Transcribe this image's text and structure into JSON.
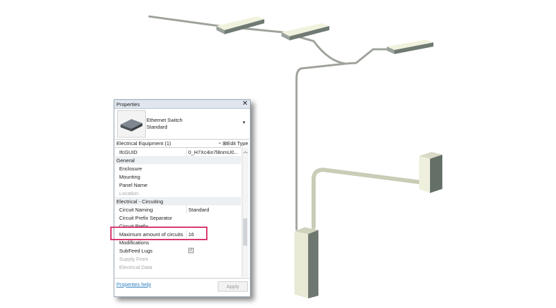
{
  "properties": {
    "title": "Properties",
    "close_glyph": "✕",
    "type_selector": {
      "name_line1": "Ethernet Switch",
      "name_line2": "Standard",
      "arrow_glyph": "▾"
    },
    "filter": {
      "label": "Electrical Equipment (1)",
      "dropdown_glyph": "⌄",
      "edit_type": "Edit Type"
    },
    "rows": {
      "ifcguid": {
        "key": "IfcGUID",
        "value": "0_H7Xc4in7l8nmU0..."
      },
      "group_general": "General",
      "enclosure": "Enclosure",
      "mounting": "Mounting",
      "panel_name": "Panel Name",
      "location": "Location",
      "group_circuiting": "Electrical - Circuiting",
      "circuit_naming": {
        "key": "Circuit Naming",
        "value": "Standard"
      },
      "circuit_prefix_separator": "Circuit Prefix Separator",
      "circuit_prefix": "Circuit Prefix",
      "max_circuits": {
        "key": "Maximum amount of circuits",
        "value": "16"
      },
      "modifications": "Modifications",
      "subfeed_lugs": "SubFeed Lugs",
      "supply_from": "Supply From",
      "electrical_data": "Electrical Data"
    },
    "help_link": "Properties help",
    "apply_button": "Apply"
  },
  "colors": {
    "highlight": "#d9376e",
    "link": "#2a7ec0"
  }
}
